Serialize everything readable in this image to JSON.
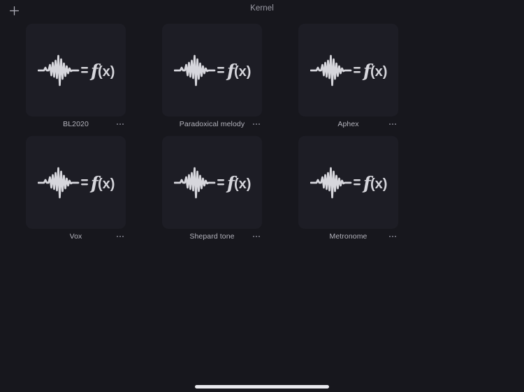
{
  "header": {
    "title": "Kernel",
    "add_icon": "plus-icon",
    "add_label": "+"
  },
  "colors": {
    "background": "#17171d",
    "card": "#1d1d25",
    "label": "#b4b4bd",
    "title": "#9c9ca6",
    "artwork": "#d6d6dc",
    "home_indicator": "#e9e9ee",
    "more_dots": "#83838e"
  },
  "artwork": {
    "equals_symbol": "=",
    "function_text": "f(x)",
    "icon": "waveform-function-icon"
  },
  "grid": {
    "items": [
      {
        "label": "BL2020",
        "more_icon": "ellipsis-icon"
      },
      {
        "label": "Paradoxical melody",
        "more_icon": "ellipsis-icon"
      },
      {
        "label": "Aphex",
        "more_icon": "ellipsis-icon"
      },
      {
        "label": "Vox",
        "more_icon": "ellipsis-icon"
      },
      {
        "label": "Shepard tone",
        "more_icon": "ellipsis-icon"
      },
      {
        "label": "Metronome",
        "more_icon": "ellipsis-icon"
      }
    ]
  },
  "footer": {
    "home_indicator": "home-indicator"
  }
}
